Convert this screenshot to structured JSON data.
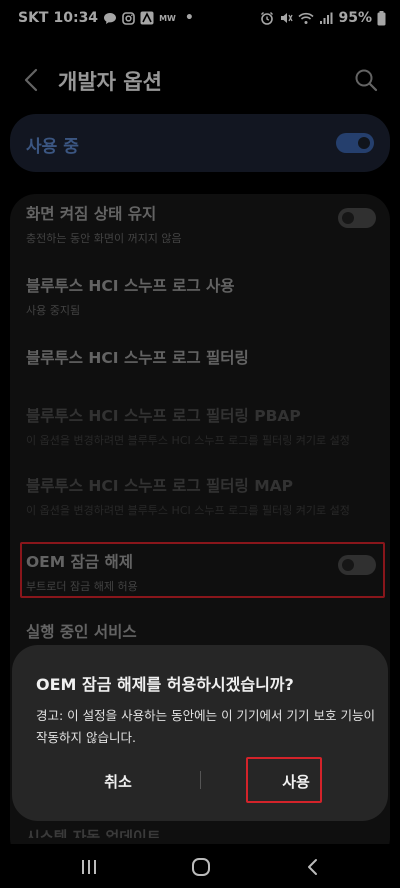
{
  "status_bar": {
    "carrier": "SKT",
    "time": "10:34",
    "battery": "95%",
    "app_icon_text": "MW",
    "dot": "•"
  },
  "header": {
    "title": "개발자 옵션"
  },
  "main_toggle": {
    "label": "사용 중",
    "state": "on"
  },
  "settings": [
    {
      "title": "화면 켜짐 상태 유지",
      "subtitle": "충전하는 동안 화면이 꺼지지 않음",
      "toggle": "off",
      "enabled": true
    },
    {
      "title": "블루투스 HCI 스누프 로그 사용",
      "subtitle": "사용 중지됨",
      "enabled": true
    },
    {
      "title": "블루투스 HCI 스누프 로그 필터링",
      "subtitle": "",
      "enabled": true
    },
    {
      "title": "블루투스 HCI 스누프 로그 필터링 PBAP",
      "subtitle": "이 옵션을 변경하려면 블루투스 HCI 스누프 로그를 필터링 켜기로 설정",
      "enabled": false
    },
    {
      "title": "블루투스 HCI 스누프 로그 필터링 MAP",
      "subtitle": "이 옵션을 변경하려면 블루투스 HCI 스누프 로그를 필터링 켜기로 설정",
      "enabled": false
    },
    {
      "title": "OEM 잠금 해제",
      "subtitle": "부트로더 잠금 해제 허용",
      "toggle": "off",
      "enabled": true
    },
    {
      "title": "실행 중인 서비스",
      "subtitle": "",
      "enabled": true
    }
  ],
  "peek_row": "시스템 자동 업데이트",
  "dialog": {
    "title": "OEM 잠금 해제를 허용하시겠습니까?",
    "message": "경고: 이 설정을 사용하는 동안에는 이 기기에서 기기 보호 기능이 작동하지 않습니다.",
    "cancel_label": "취소",
    "confirm_label": "사용"
  },
  "colors": {
    "accent": "#3a62a8",
    "highlight": "#d3232a"
  }
}
